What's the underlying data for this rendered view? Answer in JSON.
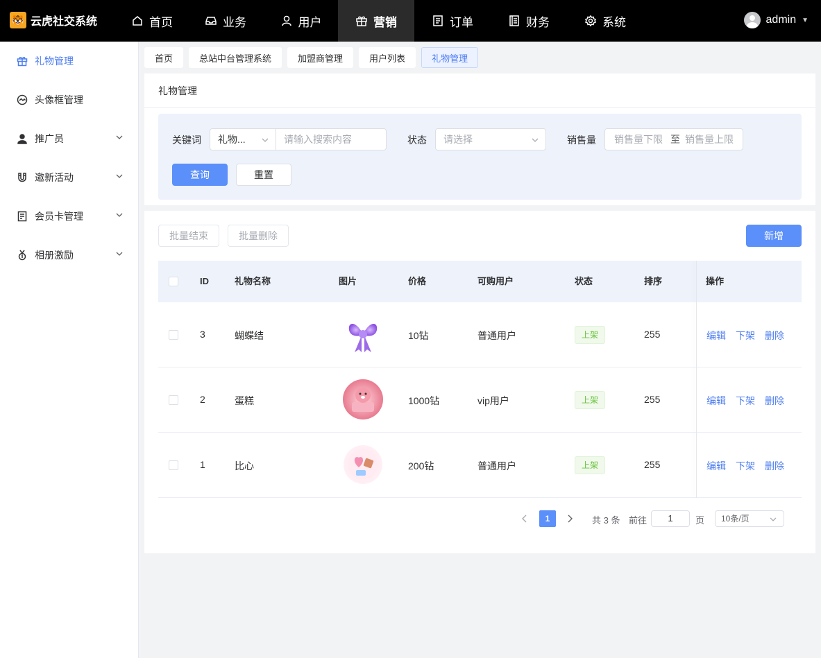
{
  "app": {
    "logo_glyph": "🐯",
    "title": "云虎社交系统"
  },
  "nav": [
    {
      "label": "首页",
      "icon": "home-icon"
    },
    {
      "label": "业务",
      "icon": "inbox-icon"
    },
    {
      "label": "用户",
      "icon": "user-icon"
    },
    {
      "label": "营销",
      "icon": "gift-icon",
      "active": true
    },
    {
      "label": "订单",
      "icon": "document-icon"
    },
    {
      "label": "财务",
      "icon": "ledger-icon"
    },
    {
      "label": "系统",
      "icon": "gear-icon"
    }
  ],
  "user": {
    "name": "admin"
  },
  "sidebar": [
    {
      "label": "礼物管理",
      "icon": "gift-icon",
      "active": true
    },
    {
      "label": "头像框管理",
      "icon": "frame-icon"
    },
    {
      "label": "推广员",
      "icon": "person-icon",
      "expandable": true
    },
    {
      "label": "邀新活动",
      "icon": "magnet-icon",
      "expandable": true
    },
    {
      "label": "会员卡管理",
      "icon": "card-icon",
      "expandable": true
    },
    {
      "label": "相册激励",
      "icon": "medal-icon",
      "expandable": true
    }
  ],
  "tags": [
    "首页",
    "总站中台管理系统",
    "加盟商管理",
    "用户列表",
    "礼物管理"
  ],
  "panel": {
    "title": "礼物管理"
  },
  "search": {
    "keyword_label": "关键词",
    "keyword_type": "礼物...",
    "keyword_placeholder": "请输入搜索内容",
    "status_label": "状态",
    "status_placeholder": "请选择",
    "sales_label": "销售量",
    "sales_min_placeholder": "销售量下限",
    "sales_sep": "至",
    "sales_max_placeholder": "销售量上限",
    "query_btn": "查询",
    "reset_btn": "重置"
  },
  "toolbar": {
    "batch_end": "批量结束",
    "batch_delete": "批量删除",
    "add": "新增"
  },
  "table": {
    "headers": {
      "id": "ID",
      "name": "礼物名称",
      "image": "图片",
      "price": "价格",
      "users": "可购用户",
      "status": "状态",
      "sort": "排序",
      "ops": "操作"
    },
    "rows": [
      {
        "id": "3",
        "name": "蝴蝶结",
        "image": "bow",
        "price": "10钻",
        "users": "普通用户",
        "status": "上架",
        "sort": "255"
      },
      {
        "id": "2",
        "name": "蛋糕",
        "image": "cake",
        "price": "1000钻",
        "users": "vip用户",
        "status": "上架",
        "sort": "255"
      },
      {
        "id": "1",
        "name": "比心",
        "image": "heart",
        "price": "200钻",
        "users": "普通用户",
        "status": "上架",
        "sort": "255"
      }
    ],
    "ops": {
      "edit": "编辑",
      "off": "下架",
      "delete": "删除"
    }
  },
  "pagination": {
    "current": "1",
    "total_text": "共 3 条",
    "goto_label": "前往",
    "goto_value": "1",
    "page_unit": "页",
    "page_size": "10条/页"
  },
  "colors": {
    "primary": "#5b8ff9",
    "link": "#4e7ef0",
    "success": "#67c23a",
    "topbar": "#000000"
  }
}
